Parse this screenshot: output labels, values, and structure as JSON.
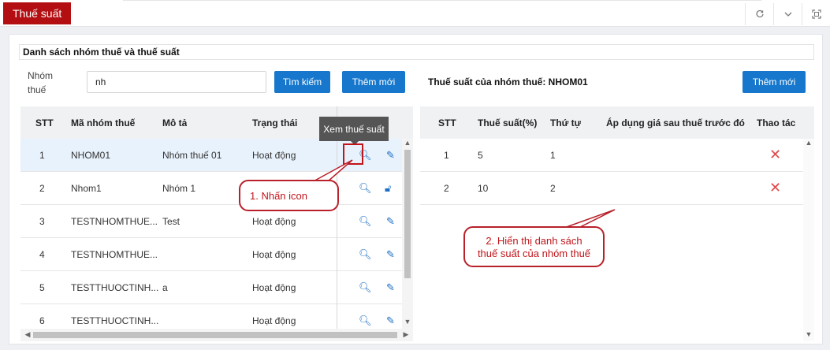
{
  "tabs": {
    "active": "Thuế suất"
  },
  "window_tools": {
    "refresh_icon": "refresh-icon",
    "collapse_icon": "chevron-down-icon",
    "fullscreen_icon": "fullscreen-icon"
  },
  "section_title": "Danh sách nhóm thuế và thuế suất",
  "filter": {
    "label": "Nhóm thuế",
    "value": "nh",
    "search_label": "Tìm kiếm",
    "add_label": "Thêm mới"
  },
  "right_panel": {
    "title": "Thuế suất của nhóm thuế: NHOM01",
    "add_label": "Thêm mới"
  },
  "left_table": {
    "columns": [
      "STT",
      "Mã nhóm thuế",
      "Mô tả",
      "Trạng thái",
      "Thao tác"
    ],
    "rows": [
      {
        "stt": "1",
        "code": "NHOM01",
        "desc": "Nhóm thuế 01",
        "status": "Hoạt động"
      },
      {
        "stt": "2",
        "code": "Nhom1",
        "desc": "Nhóm 1",
        "status": ""
      },
      {
        "stt": "3",
        "code": "TESTNHOMTHUE...",
        "desc": "Test",
        "status": "Hoạt động"
      },
      {
        "stt": "4",
        "code": "TESTNHOMTHUE...",
        "desc": "",
        "status": "Hoạt động"
      },
      {
        "stt": "5",
        "code": "TESTTHUOCTINH...",
        "desc": "a",
        "status": "Hoạt động"
      },
      {
        "stt": "6",
        "code": "TESTTHUOCTINH...",
        "desc": "",
        "status": "Hoạt động"
      }
    ]
  },
  "right_table": {
    "columns": [
      "STT",
      "Thuế suất(%)",
      "Thứ tự",
      "Áp dụng giá sau thuế trước đó",
      "Thao tác"
    ],
    "rows": [
      {
        "stt": "1",
        "rate": "5",
        "order": "1"
      },
      {
        "stt": "2",
        "rate": "10",
        "order": "2"
      }
    ]
  },
  "tooltip": "Xem thuế suất",
  "annotations": {
    "step1": "1. Nhấn icon",
    "step2_line1": "2. Hiển thị danh sách",
    "step2_line2": "thuế suất của nhóm thuế"
  },
  "colors": {
    "brand_red": "#b30f12",
    "primary_blue": "#1677cc",
    "annotation_red": "#c0151b",
    "delete_red": "#e04848"
  }
}
